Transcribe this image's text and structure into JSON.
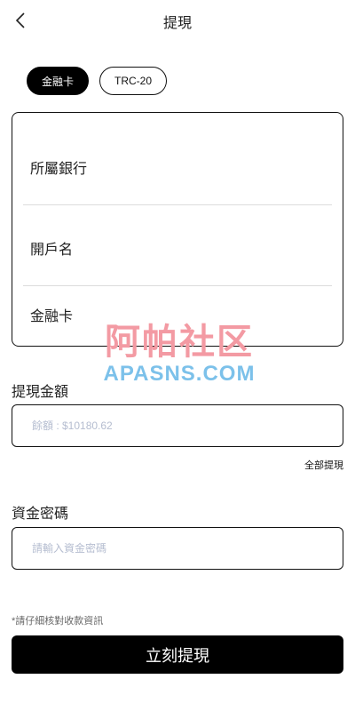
{
  "header": {
    "title": "提現",
    "back_icon": "chevron-left-icon"
  },
  "tabs": [
    {
      "label": "金融卡",
      "active": true
    },
    {
      "label": "TRC-20",
      "active": false
    }
  ],
  "card_fields": {
    "bank": "所屬銀行",
    "account_name": "開戶名",
    "card": "金融卡"
  },
  "watermark": {
    "cn": "阿帕社区",
    "en": "APASNS.COM"
  },
  "amount": {
    "label": "提現金額",
    "placeholder": "餘額 : $10180.62",
    "withdraw_all": "全部提現"
  },
  "password": {
    "label": "資金密碼",
    "placeholder": "請輸入資金密碼"
  },
  "note": "*請仔細核對收款資訊",
  "submit_label": "立刻提現",
  "colors": {
    "primary": "#000000",
    "border": "#111111",
    "placeholder": "#b5bdd0",
    "watermark_cn": "#f39aa3",
    "watermark_en": "#7cc1ea"
  }
}
